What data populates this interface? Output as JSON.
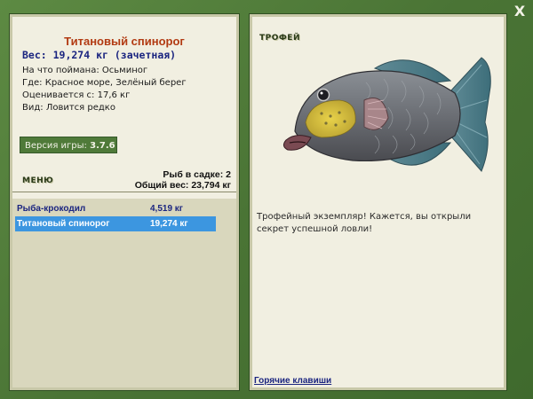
{
  "window": {
    "close_label": "X"
  },
  "fish": {
    "title": "Титановый спинорог",
    "weight_line": "Вес: 19,274 кг (зачетная)",
    "caught_on": "На что поймана: Осьминог",
    "location": "Где: Красное море, Зелёный берег",
    "rated_from": "Оценивается с: 17,6 кг",
    "kind": "Вид: Ловится редко"
  },
  "version": {
    "label": "Версия игры: ",
    "value": "3.7.6"
  },
  "menu": {
    "label": "МЕНЮ"
  },
  "net": {
    "fish_count": "Рыб в садке: 2",
    "total_weight": "Общий вес: 23,794 кг"
  },
  "catch_list": [
    {
      "name": "Рыба-крокодил",
      "weight": "4,519 кг",
      "selected": false
    },
    {
      "name": "Титановый спинорог",
      "weight": "19,274 кг",
      "selected": true
    }
  ],
  "trophy": {
    "label": "ТРОФЕЙ",
    "text": "Трофейный экземпляр! Кажется, вы открыли секрет успешной ловли!",
    "image_subject": "titan-triggerfish-image"
  },
  "hotkeys": {
    "label": "Горячие клавиши"
  },
  "colors": {
    "frame": "#4f7a39",
    "panel": "#f1efe1",
    "title_red": "#b23a12",
    "navy_text": "#1b2580",
    "selection": "#3c96e0"
  }
}
